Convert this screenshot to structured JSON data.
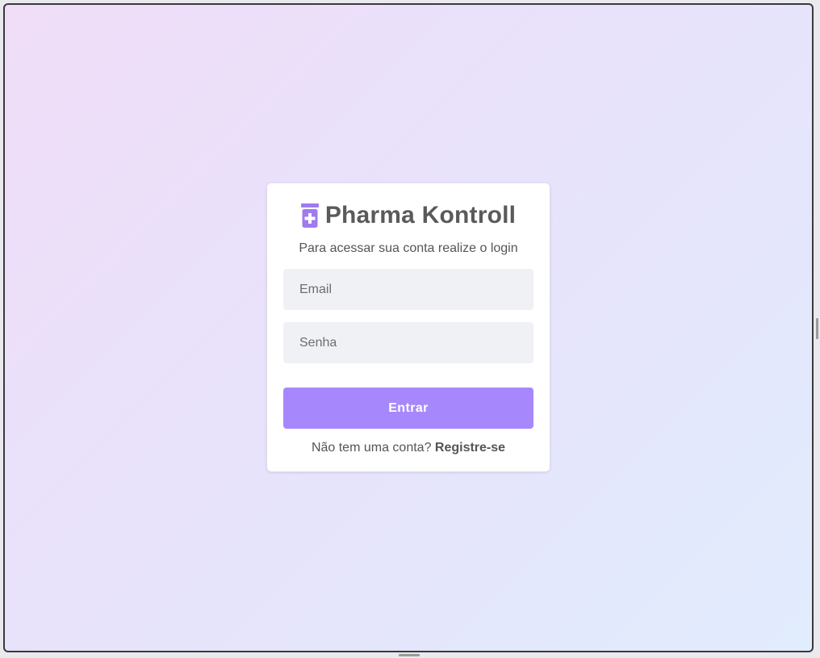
{
  "app": {
    "brand_name": "Pharma Kontroll",
    "brand_icon": "prescription-bottle-icon",
    "accent_color": "#a788fc"
  },
  "login": {
    "subtitle": "Para acessar sua conta realize o login",
    "email_placeholder": "Email",
    "password_placeholder": "Senha",
    "submit_label": "Entrar",
    "signup_prompt": "Não tem uma conta?",
    "signup_link": "Registre-se"
  }
}
